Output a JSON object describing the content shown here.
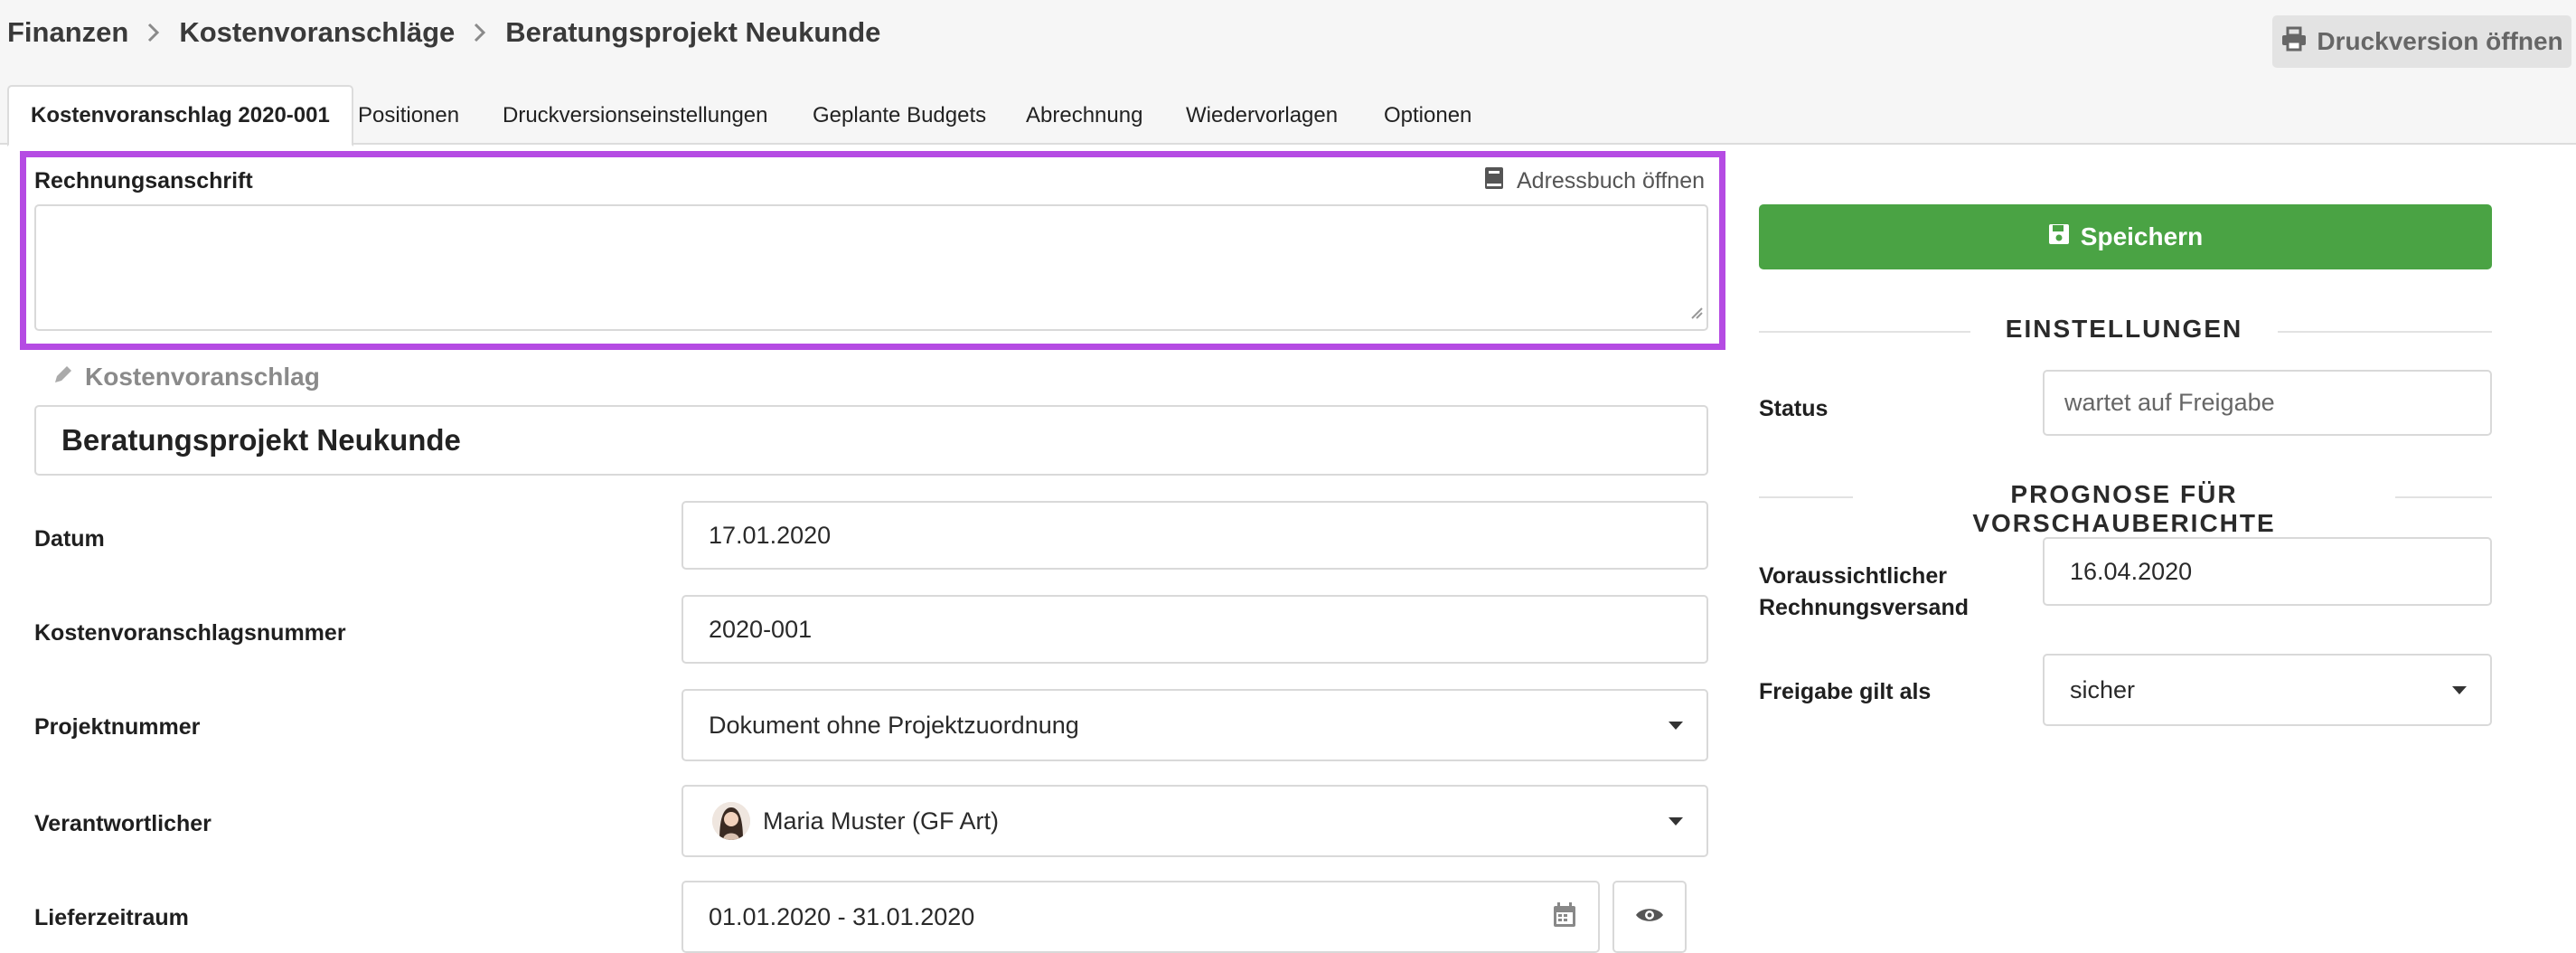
{
  "breadcrumb": {
    "items": [
      "Finanzen",
      "Kostenvoranschläge",
      "Beratungsprojekt Neukunde"
    ]
  },
  "header": {
    "print_label": "Druckversion öffnen"
  },
  "tabs": [
    {
      "label": "Kostenvoranschlag 2020-001",
      "active": true
    },
    {
      "label": "Positionen"
    },
    {
      "label": "Druckversionseinstellungen"
    },
    {
      "label": "Geplante Budgets"
    },
    {
      "label": "Abrechnung"
    },
    {
      "label": "Wiedervorlagen"
    },
    {
      "label": "Optionen"
    }
  ],
  "form": {
    "billing_address": {
      "label": "Rechnungsanschrift",
      "address_book_label": "Adressbuch öffnen",
      "value": ""
    },
    "title": {
      "label": "Kostenvoranschlag",
      "value": "Beratungsprojekt Neukunde"
    },
    "date": {
      "label": "Datum",
      "value": "17.01.2020"
    },
    "number": {
      "label": "Kostenvoranschlagsnummer",
      "value": "2020-001"
    },
    "project": {
      "label": "Projektnummer",
      "value": "Dokument ohne Projektzuordnung"
    },
    "responsible": {
      "label": "Verantwortlicher",
      "value": "Maria Muster (GF Art)"
    },
    "delivery_period": {
      "label": "Lieferzeitraum",
      "value": "01.01.2020 - 31.01.2020"
    }
  },
  "sidebar": {
    "save_label": "Speichern",
    "settings_title": "EINSTELLUNGEN",
    "status": {
      "label": "Status",
      "placeholder": "wartet auf Freigabe"
    },
    "forecast_title": "PROGNOSE FÜR VORSCHAUBERICHTE",
    "expected_invoice": {
      "label_line1": "Voraussichtlicher",
      "label_line2": "Rechnungsversand",
      "value": "16.04.2020"
    },
    "release": {
      "label": "Freigabe gilt als",
      "value": "sicher"
    }
  },
  "colors": {
    "accent_highlight": "#b54be3",
    "save_green": "#4aa344",
    "background_gray": "#f6f6f6"
  }
}
